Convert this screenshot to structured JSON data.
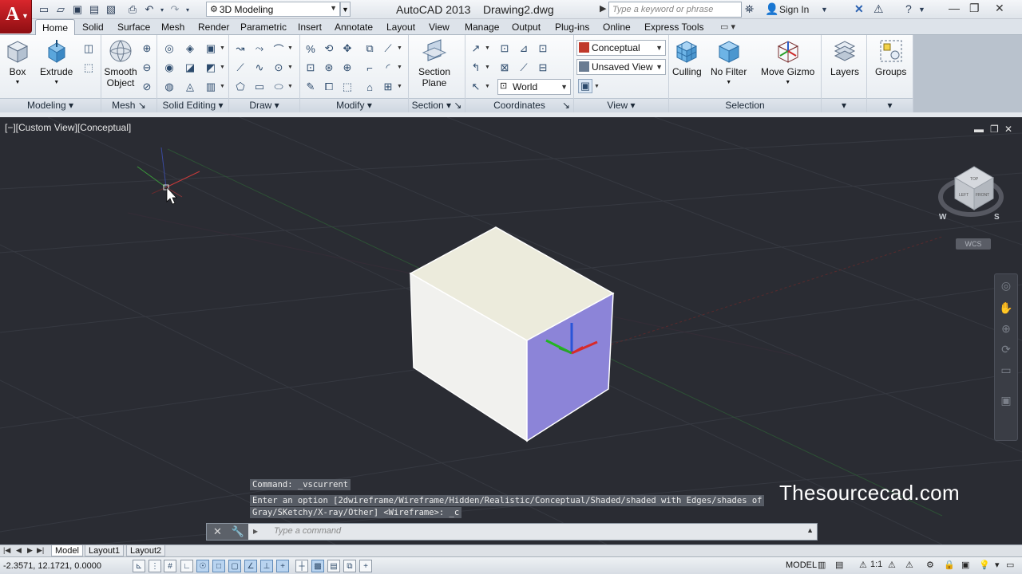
{
  "titlebar": {
    "workspace": "3D Modeling",
    "title": "AutoCAD 2013    Drawing2.dwg",
    "search_placeholder": "Type a keyword or phrase",
    "signin": "Sign In"
  },
  "tabs": [
    "Home",
    "Solid",
    "Surface",
    "Mesh",
    "Render",
    "Parametric",
    "Insert",
    "Annotate",
    "Layout",
    "View",
    "Manage",
    "Output",
    "Plug-ins",
    "Online",
    "Express Tools"
  ],
  "ribbon": {
    "modeling": {
      "title": "Modeling",
      "box": "Box",
      "extrude": "Extrude"
    },
    "mesh": {
      "title": "Mesh",
      "smooth_object": "Smooth Object"
    },
    "solid_editing": {
      "title": "Solid Editing"
    },
    "draw": {
      "title": "Draw"
    },
    "modify": {
      "title": "Modify"
    },
    "section": {
      "title": "Section",
      "section_plane": "Section Plane"
    },
    "coordinates": {
      "title": "Coordinates",
      "world": "World"
    },
    "view": {
      "title": "View",
      "visual_style": "Conceptual",
      "saved_view": "Unsaved View"
    },
    "selection": {
      "title": "Selection",
      "culling": "Culling",
      "no_filter": "No Filter",
      "move_gizmo": "Move Gizmo"
    },
    "layers": {
      "label": "Layers"
    },
    "groups": {
      "label": "Groups"
    }
  },
  "viewport": {
    "label": "[−][Custom View][Conceptual]",
    "viewcube_wcs": "WCS",
    "viewcube_faces": {
      "top": "TOP",
      "left": "LEFT",
      "front": "FRONT"
    },
    "compass": {
      "w": "W",
      "s": "S"
    },
    "watermark": "Thesourcecad.com"
  },
  "command": {
    "history_1": "Command: _vscurrent",
    "history_2": "Enter an option [2dwireframe/Wireframe/Hidden/Realistic/Conceptual/Shaded/shaded with Edges/shades of",
    "history_3": "Gray/SKetchy/X-ray/Other] <Wireframe>: _c",
    "placeholder": "Type a command"
  },
  "layout_tabs": [
    "Model",
    "Layout1",
    "Layout2"
  ],
  "status": {
    "coords": "-2.3571, 12.1721, 0.0000",
    "model": "MODEL",
    "scale": "1:1"
  },
  "colors": {
    "viewport_bg": "#2a2c33",
    "box_top": "#ecebdc",
    "box_front": "#f1f1ee",
    "box_right": "#8c84d8",
    "brand_red": "#c4161c"
  }
}
